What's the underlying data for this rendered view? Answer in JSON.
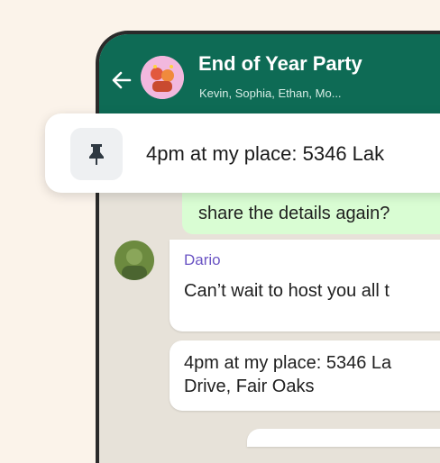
{
  "chat": {
    "title": "End of Year Party",
    "members": "Kevin, Sophia, Ethan, Mo..."
  },
  "pinned": {
    "text": "4pm at my place: 5346 Lak",
    "icon": "pin-icon"
  },
  "messages": [
    {
      "direction": "out",
      "text": "share the details again?"
    },
    {
      "direction": "in",
      "sender": "Dario",
      "text": "Can’t wait to host you all t"
    },
    {
      "direction": "in",
      "lines": [
        "4pm at my place: 5346 La",
        "Drive, Fair Oaks"
      ]
    }
  ],
  "colors": {
    "header": "#0e6b55",
    "outgoing_bubble": "#d9fdd3",
    "chat_background": "#e7e2d9",
    "sender_name": "#6b55c4"
  }
}
